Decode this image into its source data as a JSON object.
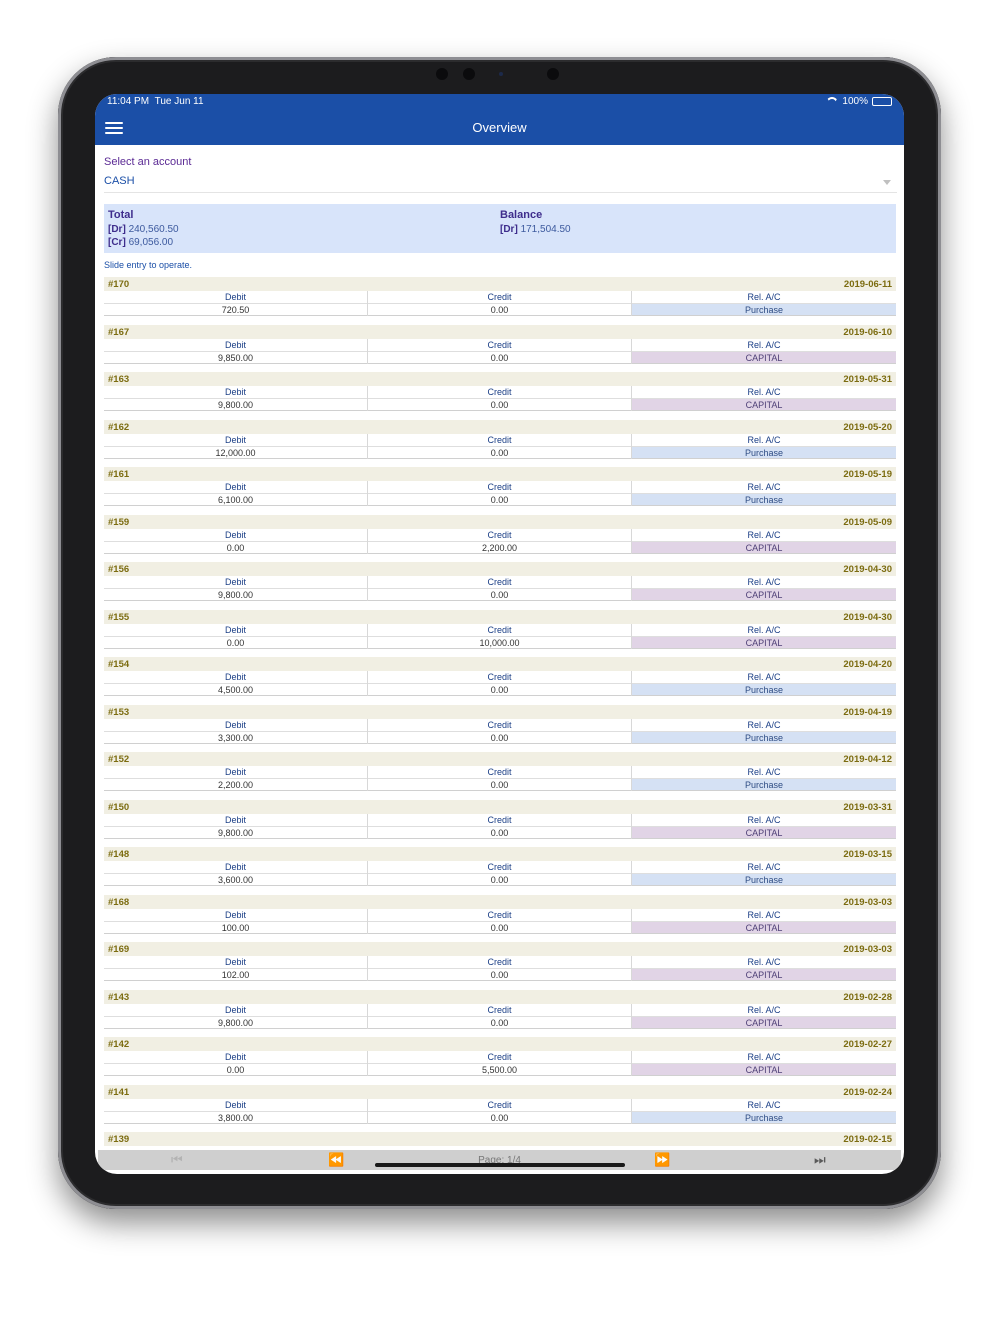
{
  "status_bar": {
    "time": "11:04 PM",
    "date": "Tue Jun 11",
    "battery": "100%"
  },
  "header": {
    "title": "Overview"
  },
  "account": {
    "label": "Select an account",
    "value": "CASH"
  },
  "summary": {
    "total_title": "Total",
    "total_dr_tag": "[Dr]",
    "total_dr": "240,560.50",
    "total_cr_tag": "[Cr]",
    "total_cr": "69,056.00",
    "balance_title": "Balance",
    "balance_tag": "[Dr]",
    "balance": "171,504.50"
  },
  "hint": "Slide entry to operate.",
  "columns": {
    "debit": "Debit",
    "credit": "Credit",
    "rel": "Rel. A/C"
  },
  "entries": [
    {
      "id": "#170",
      "date": "2019-06-11",
      "debit": "720.50",
      "credit": "0.00",
      "rel": "Purchase"
    },
    {
      "id": "#167",
      "date": "2019-06-10",
      "debit": "9,850.00",
      "credit": "0.00",
      "rel": "CAPITAL"
    },
    {
      "id": "#163",
      "date": "2019-05-31",
      "debit": "9,800.00",
      "credit": "0.00",
      "rel": "CAPITAL"
    },
    {
      "id": "#162",
      "date": "2019-05-20",
      "debit": "12,000.00",
      "credit": "0.00",
      "rel": "Purchase"
    },
    {
      "id": "#161",
      "date": "2019-05-19",
      "debit": "6,100.00",
      "credit": "0.00",
      "rel": "Purchase"
    },
    {
      "id": "#159",
      "date": "2019-05-09",
      "debit": "0.00",
      "credit": "2,200.00",
      "rel": "CAPITAL"
    },
    {
      "id": "#156",
      "date": "2019-04-30",
      "debit": "9,800.00",
      "credit": "0.00",
      "rel": "CAPITAL"
    },
    {
      "id": "#155",
      "date": "2019-04-30",
      "debit": "0.00",
      "credit": "10,000.00",
      "rel": "CAPITAL"
    },
    {
      "id": "#154",
      "date": "2019-04-20",
      "debit": "4,500.00",
      "credit": "0.00",
      "rel": "Purchase"
    },
    {
      "id": "#153",
      "date": "2019-04-19",
      "debit": "3,300.00",
      "credit": "0.00",
      "rel": "Purchase"
    },
    {
      "id": "#152",
      "date": "2019-04-12",
      "debit": "2,200.00",
      "credit": "0.00",
      "rel": "Purchase"
    },
    {
      "id": "#150",
      "date": "2019-03-31",
      "debit": "9,800.00",
      "credit": "0.00",
      "rel": "CAPITAL"
    },
    {
      "id": "#148",
      "date": "2019-03-15",
      "debit": "3,600.00",
      "credit": "0.00",
      "rel": "Purchase"
    },
    {
      "id": "#168",
      "date": "2019-03-03",
      "debit": "100.00",
      "credit": "0.00",
      "rel": "CAPITAL"
    },
    {
      "id": "#169",
      "date": "2019-03-03",
      "debit": "102.00",
      "credit": "0.00",
      "rel": "CAPITAL"
    },
    {
      "id": "#143",
      "date": "2019-02-28",
      "debit": "9,800.00",
      "credit": "0.00",
      "rel": "CAPITAL"
    },
    {
      "id": "#142",
      "date": "2019-02-27",
      "debit": "0.00",
      "credit": "5,500.00",
      "rel": "CAPITAL"
    },
    {
      "id": "#141",
      "date": "2019-02-24",
      "debit": "3,800.00",
      "credit": "0.00",
      "rel": "Purchase"
    },
    {
      "id": "#139",
      "date": "2019-02-15"
    }
  ],
  "pagination": {
    "label": "Page: 1/4",
    "first_icon": "skip-first-icon",
    "prev_icon": "rewind-icon",
    "next_icon": "fast-forward-icon",
    "last_icon": "skip-last-icon"
  },
  "colors": {
    "brand": "#1b4fa7",
    "summary_bg": "#d8e4fa",
    "entry_header_bg": "#f1efe3",
    "purchase_bg": "#d5e1f4",
    "capital_bg": "#e1d4e6"
  }
}
